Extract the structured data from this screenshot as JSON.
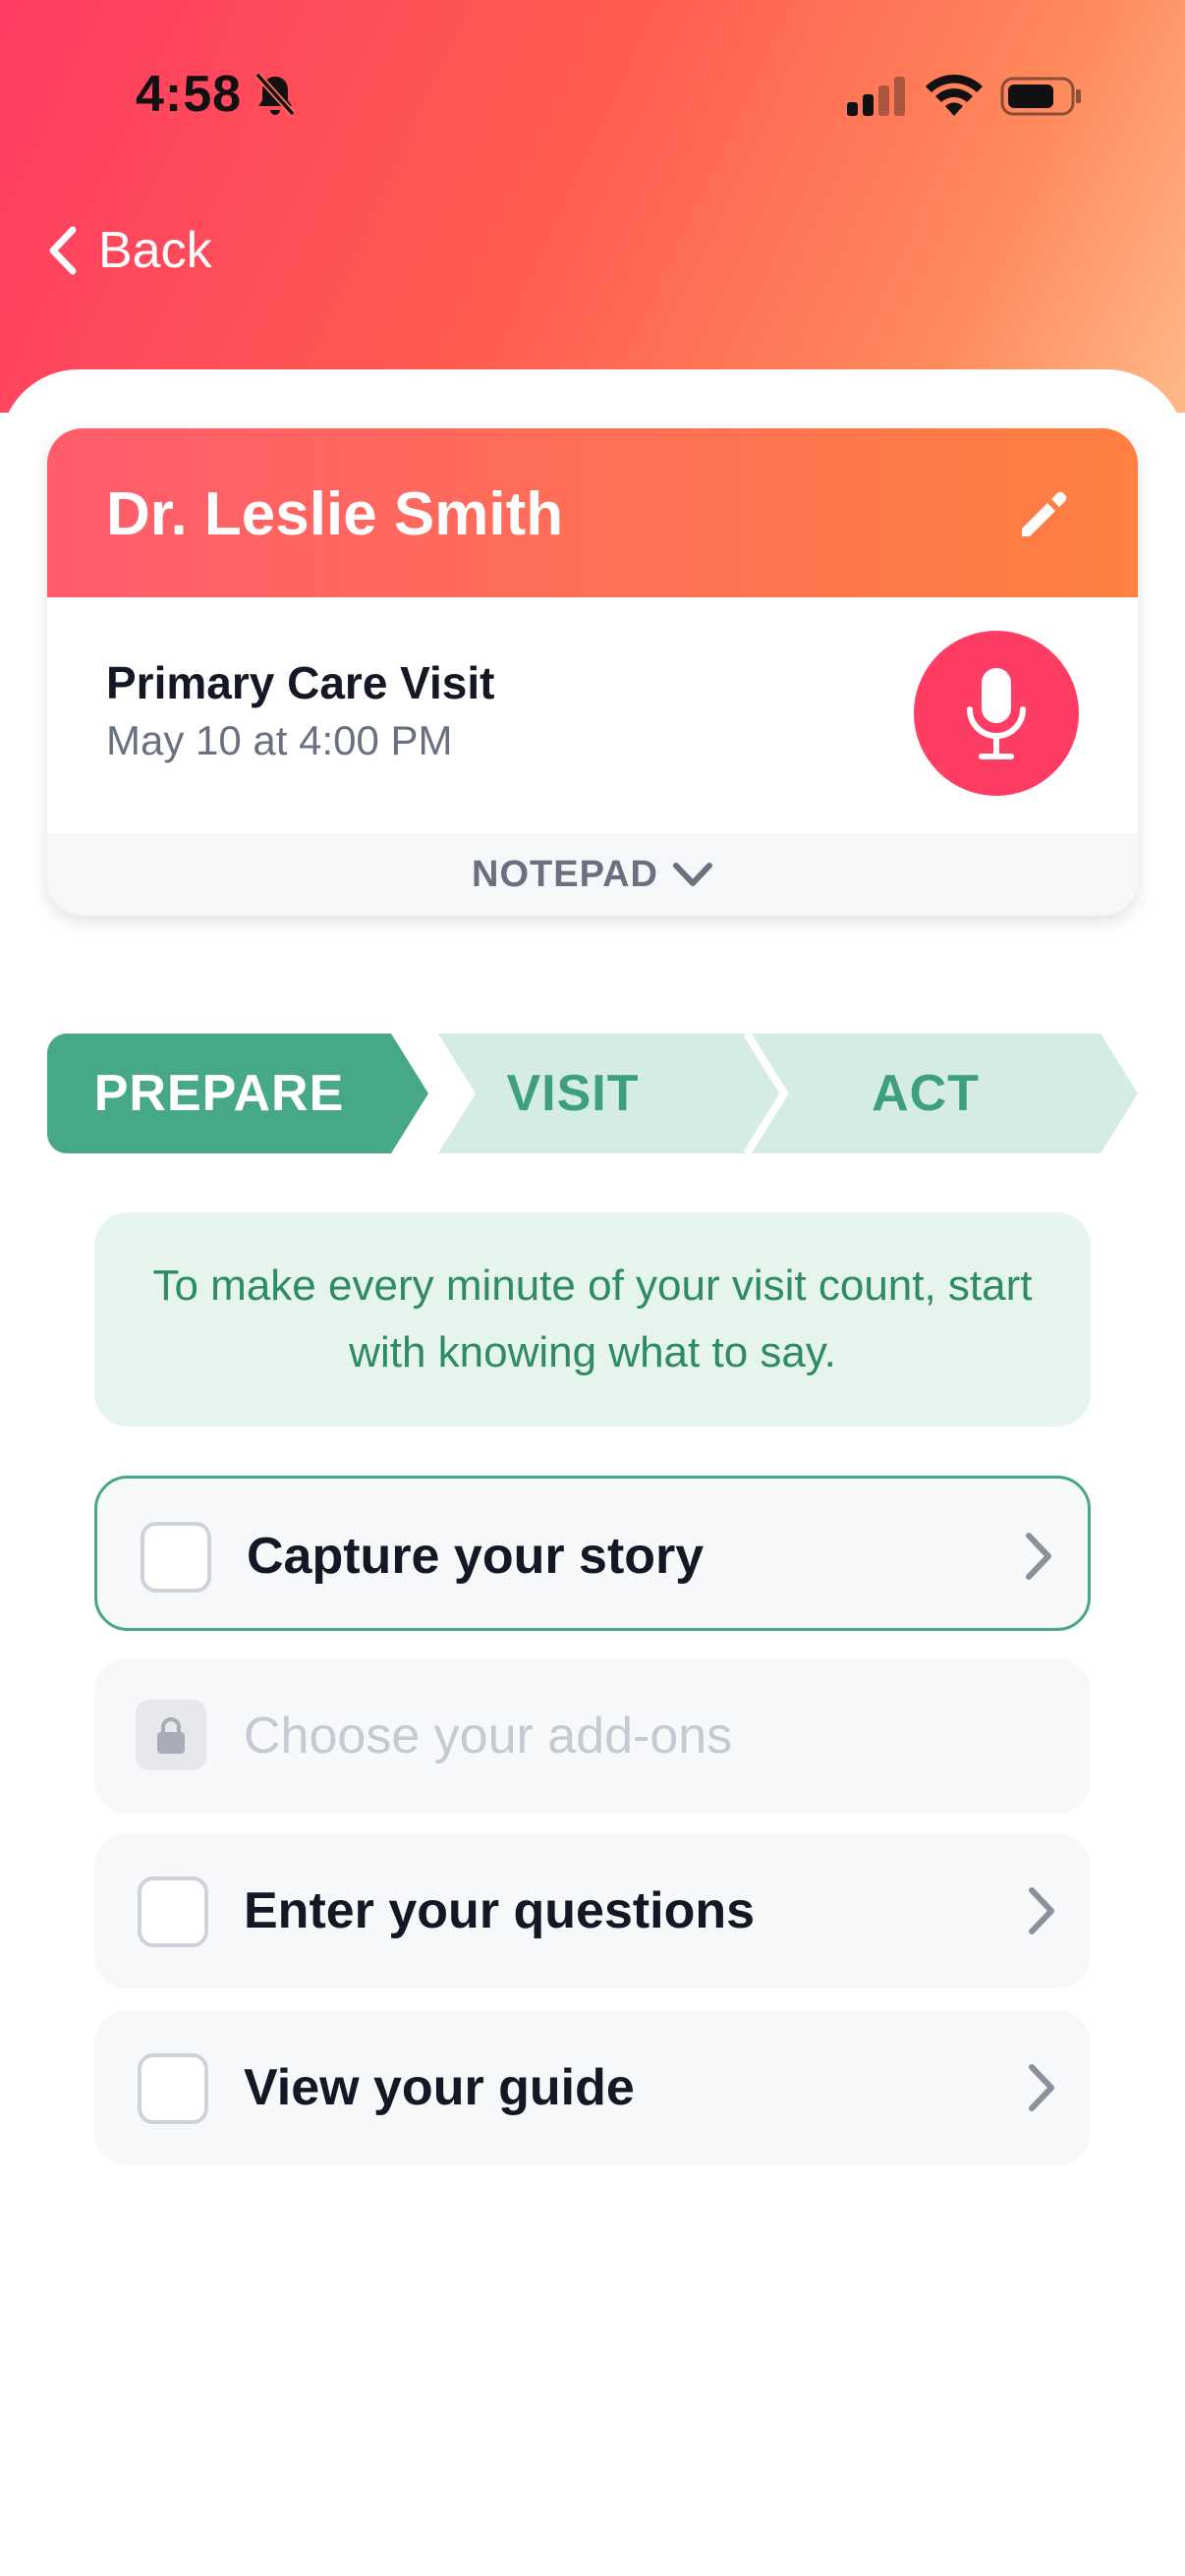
{
  "status_bar": {
    "time": "4:58"
  },
  "nav": {
    "back_label": "Back"
  },
  "appointment": {
    "doctor_name": "Dr. Leslie Smith",
    "visit_type": "Primary Care Visit",
    "visit_datetime": "May 10 at 4:00 PM",
    "notepad_label": "NOTEPAD"
  },
  "steps": [
    {
      "label": "PREPARE",
      "active": true
    },
    {
      "label": "VISIT",
      "active": false
    },
    {
      "label": "ACT",
      "active": false
    }
  ],
  "intro_text": "To make every minute of your visit count, start with knowing what to say.",
  "tasks": [
    {
      "label": "Capture your story",
      "state": "active"
    },
    {
      "label": "Choose your add-ons",
      "state": "locked"
    },
    {
      "label": "Enter your questions",
      "state": "todo"
    },
    {
      "label": "View your guide",
      "state": "todo"
    }
  ],
  "colors": {
    "brand_red": "#ff3c64",
    "brand_orange": "#ff8040",
    "green": "#46a888",
    "green_light": "#d4ece3"
  }
}
